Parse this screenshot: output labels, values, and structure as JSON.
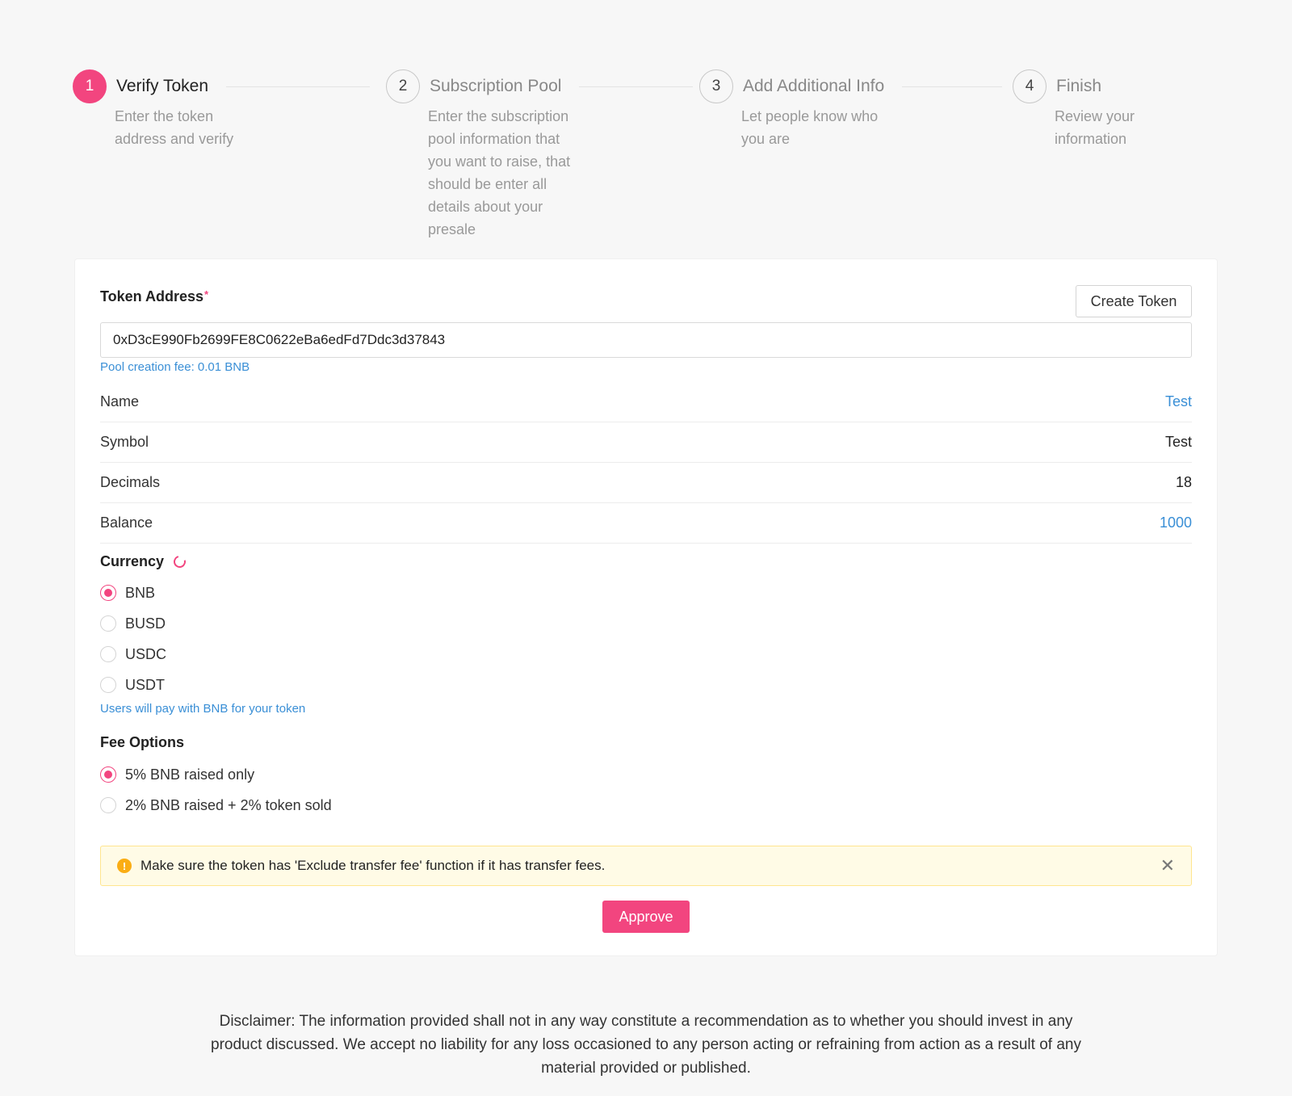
{
  "steps": [
    {
      "number": "1",
      "title": "Verify Token",
      "desc": "Enter the token address and verify",
      "active": true
    },
    {
      "number": "2",
      "title": "Subscription Pool",
      "desc": "Enter the subscription pool information that you want to raise, that should be enter all details about your presale",
      "active": false
    },
    {
      "number": "3",
      "title": "Add Additional Info",
      "desc": "Let people know who you are",
      "active": false
    },
    {
      "number": "4",
      "title": "Finish",
      "desc": "Review your information",
      "active": false
    }
  ],
  "form": {
    "token_address_label": "Token Address",
    "required_mark": "*",
    "create_token_label": "Create Token",
    "token_address_value": "0xD3cE990Fb2699FE8C0622eBa6edFd7Ddc3d37843",
    "pool_fee_hint": "Pool creation fee: 0.01 BNB"
  },
  "token_info": [
    {
      "label": "Name",
      "value": "Test"
    },
    {
      "label": "Symbol",
      "value": "Test"
    },
    {
      "label": "Decimals",
      "value": "18"
    },
    {
      "label": "Balance",
      "value": "1000"
    }
  ],
  "currency": {
    "title": "Currency",
    "options": [
      "BNB",
      "BUSD",
      "USDC",
      "USDT"
    ],
    "selected": "BNB",
    "hint": "Users will pay with BNB for your token"
  },
  "fee_options": {
    "title": "Fee Options",
    "options": [
      "5% BNB raised only",
      "2% BNB raised + 2% token sold"
    ],
    "selected": "5% BNB raised only"
  },
  "alert": {
    "icon": "!",
    "text": "Make sure the token has 'Exclude transfer fee' function if it has transfer fees.",
    "close": "✕"
  },
  "approve_label": "Approve",
  "disclaimer": "Disclaimer: The information provided shall not in any way constitute a recommendation as to whether you should invest in any product discussed. We accept no liability for any loss occasioned to any person acting or refraining from action as a result of any material provided or published.",
  "colors": {
    "accent": "#f2457f",
    "link": "#3a8fd6",
    "warning": "#faad14"
  }
}
